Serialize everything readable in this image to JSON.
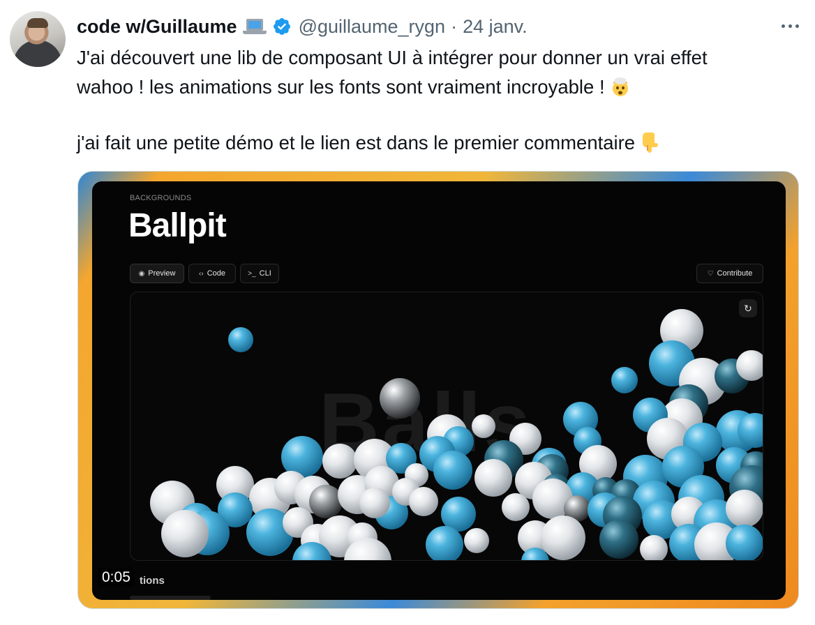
{
  "tweet": {
    "author_name": "code w/Guillaume",
    "author_badge_icon": "laptop-icon",
    "verified_icon": "verified-badge-icon",
    "handle": "@guillaume_rygn",
    "separator": "·",
    "date": "24 janv.",
    "text_lines": [
      "J'ai découvert une lib de composant UI à intégrer pour donner un vrai effet",
      "wahoo ! les animations sur les fonts sont vraiment incroyable !"
    ],
    "text_line_3": "j'ai fait une petite démo et le lien est dans le premier commentaire",
    "emoji_1": "exploding-head-icon",
    "emoji_2": "pointing-down-icon"
  },
  "video": {
    "kicker": "BACKGROUNDS",
    "title": "Ballpit",
    "tabs": [
      {
        "label": "Preview",
        "icon": "eye-icon"
      },
      {
        "label": "Code",
        "icon": "code-icon"
      },
      {
        "label": "CLI",
        "icon": "terminal-icon"
      }
    ],
    "contribute_label": "Contribute",
    "ghost_word": "Balls",
    "options_label": "tions",
    "timestamp": "0:05"
  },
  "colors": {
    "accent_blue": "#1d9bf0",
    "ball_blue": "#3fa9d6",
    "ball_white": "#e6e9ec",
    "ball_dark": "#2f6f86"
  }
}
